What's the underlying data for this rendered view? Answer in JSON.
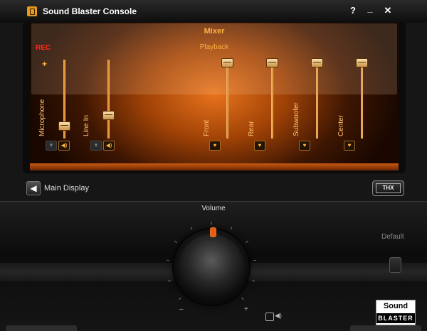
{
  "window": {
    "title": "Sound Blaster Console",
    "help_label": "?",
    "minimize_label": "_",
    "close_label": "✕"
  },
  "mixer": {
    "heading": "Mixer",
    "rec_label": "REC",
    "playback_label": "Playback",
    "plus_label": "+",
    "recording_channels": [
      {
        "label": "Microphone",
        "level": 0.1
      },
      {
        "label": "Line In",
        "level": 0.25
      }
    ],
    "playback_channels": [
      {
        "label": "Front",
        "level": 1.0
      },
      {
        "label": "Rear",
        "level": 1.0
      },
      {
        "label": "Subwoofer",
        "level": 1.0
      },
      {
        "label": "Center",
        "level": 1.0
      }
    ],
    "colors": {
      "accent": "#ffb040",
      "rec": "#ff2a1a",
      "glow": "#e8731c"
    }
  },
  "nav": {
    "back_icon": "arrow-left-icon",
    "main_display_label": "Main Display",
    "thx_label": "THX"
  },
  "volume": {
    "label": "Volume",
    "minus_label": "–",
    "plus_label": "+",
    "speaker_symbol": "◀)",
    "default_label": "Default"
  },
  "brand": {
    "line1": "Sound",
    "line2": "BLASTER"
  }
}
